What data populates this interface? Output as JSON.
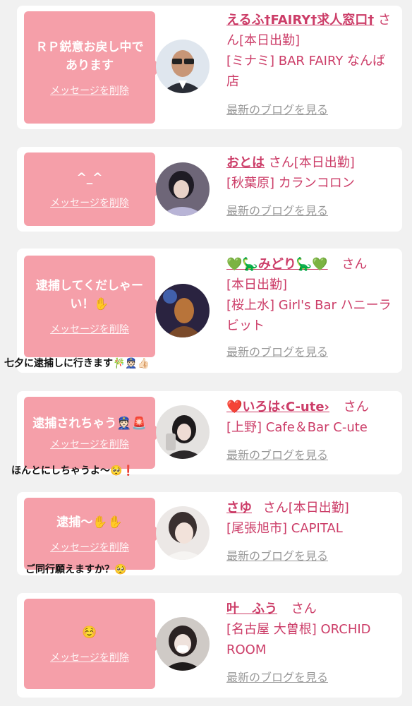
{
  "delete_label": "メッセージを削除",
  "blog_label": "最新のブログを見る",
  "san_suffix": "さん",
  "colors": {
    "accent": "#cc3d68",
    "bubble": "#f59fa9",
    "background": "#f1f1f1"
  },
  "cards": [
    {
      "message": "ＲＰ鋭意お戻し中であります",
      "name": "えるふ†FAIRY†求人窓口†",
      "status": "[本日出勤]",
      "shop": "[ミナミ] BAR FAIRY なんば店",
      "float_note": ""
    },
    {
      "message": "^_^",
      "name": "おとは",
      "status": "[本日出勤]",
      "shop": "[秋葉原] カランコロン",
      "float_note": ""
    },
    {
      "message": "逮捕してくだしゃーい！✋",
      "name": "💚🦕みどり🦕💚",
      "status": "[本日出勤]",
      "shop": "[桜上水] Girl's Bar ハニーラビット",
      "float_note": "七夕に逮捕しに行きます🎋👮🏻👍🏻"
    },
    {
      "message": "逮捕されちゃう👮🏻🚨",
      "name": "❤️いろは‹C-ute›",
      "status": "",
      "shop": "[上野] Cafe＆Bar C-ute",
      "float_note": "ほんとにしちゃうよ〜🥺❗"
    },
    {
      "message": "逮捕〜✋✋",
      "name": "さゆ",
      "status": "[本日出勤]",
      "shop": "[尾張旭市] CAPITAL",
      "float_note": "ご同行願えますか？🥺"
    },
    {
      "message": "☺️",
      "name": "叶　ふう",
      "status": "",
      "shop": "[名古屋 大曽根] ORCHID ROOM",
      "float_note": ""
    }
  ]
}
